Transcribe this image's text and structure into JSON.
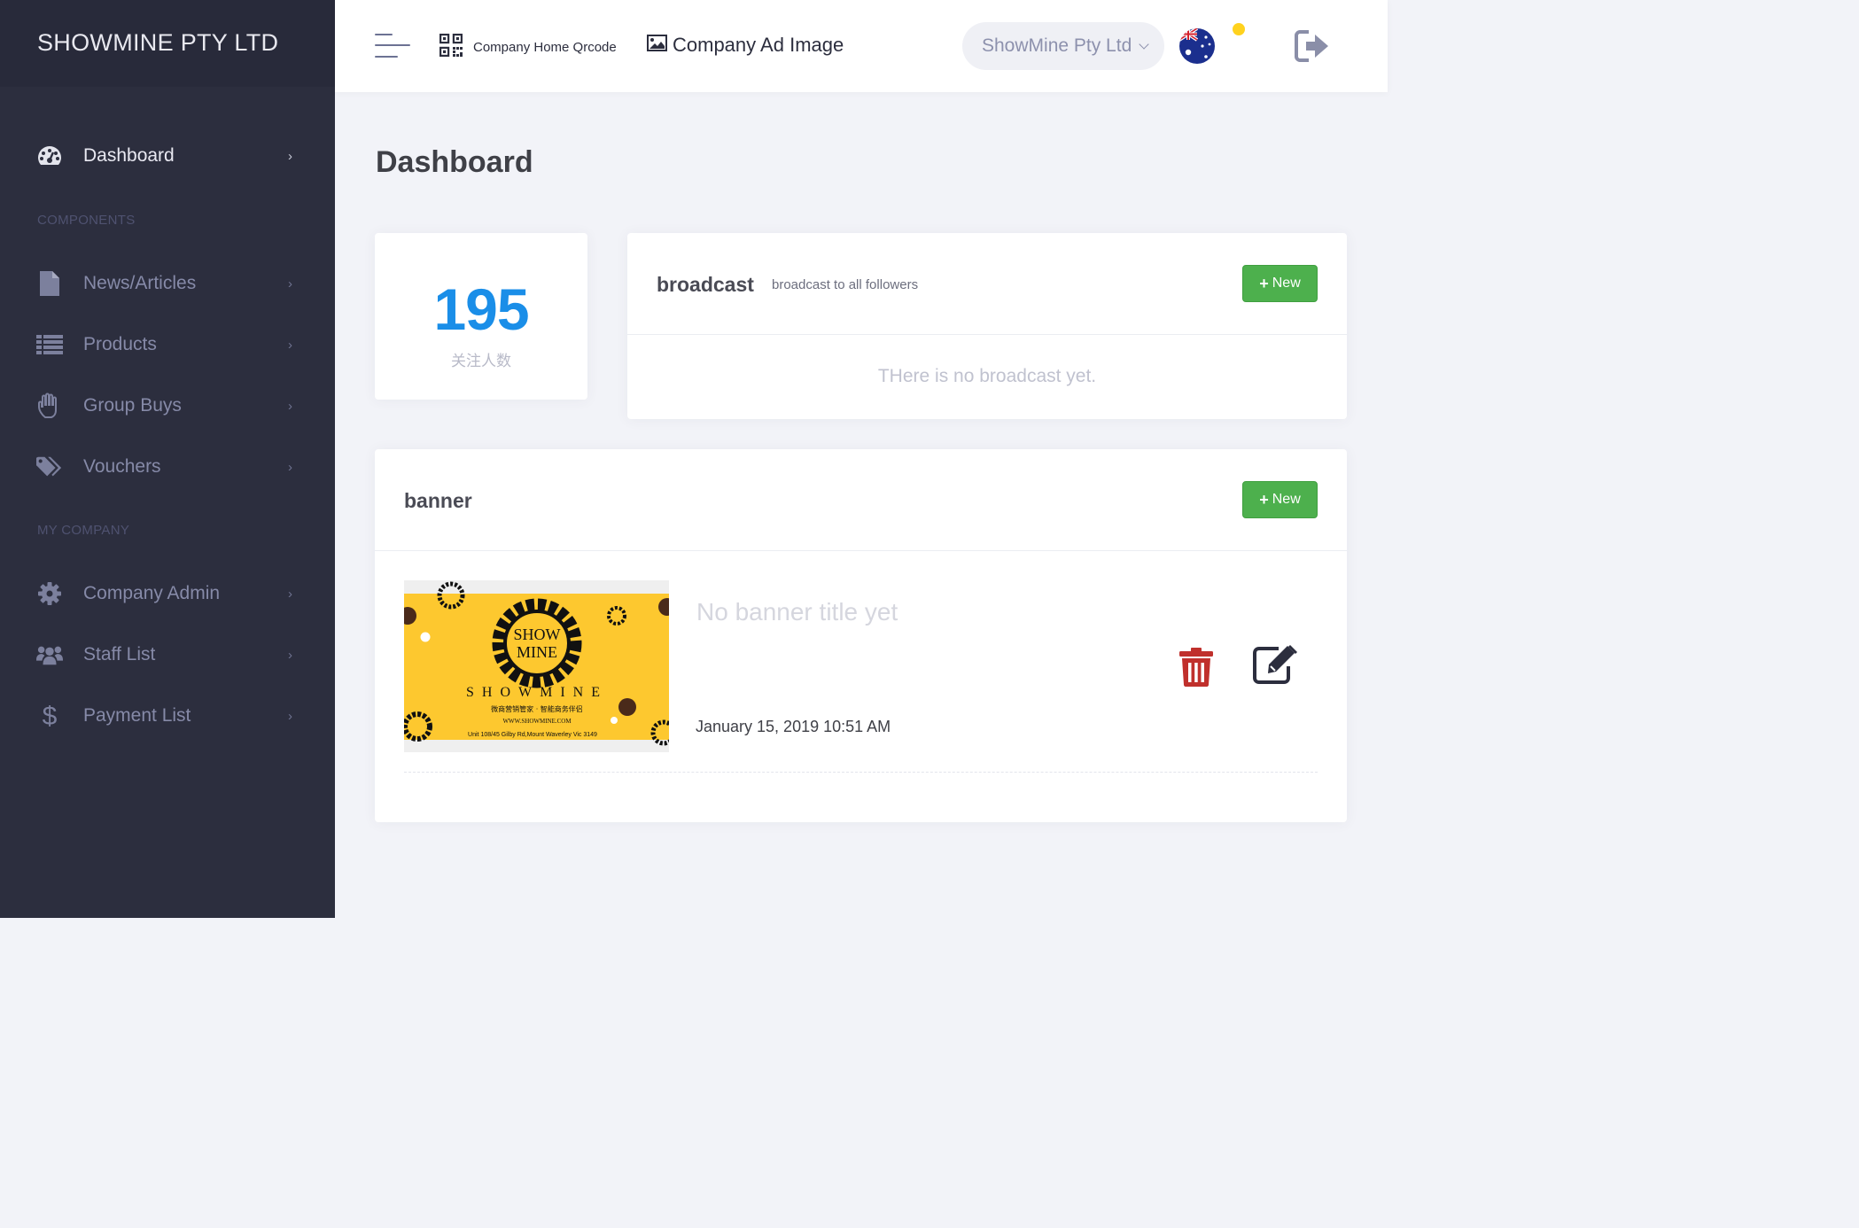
{
  "brand": {
    "name": "SHOWMINE PTY LTD"
  },
  "sidebar": {
    "items": [
      {
        "label": "Dashboard",
        "icon": "dashboard-icon",
        "active": true
      },
      {
        "label": "News/Articles",
        "icon": "document-icon"
      },
      {
        "label": "Products",
        "icon": "list-icon"
      },
      {
        "label": "Group Buys",
        "icon": "hand-icon"
      },
      {
        "label": "Vouchers",
        "icon": "tags-icon"
      },
      {
        "label": "Company Admin",
        "icon": "gear-icon"
      },
      {
        "label": "Staff List",
        "icon": "users-icon"
      },
      {
        "label": "Payment List",
        "icon": "dollar-icon"
      }
    ],
    "sections": {
      "components": "COMPONENTS",
      "my_company": "MY COMPANY"
    },
    "chevron": "›"
  },
  "header": {
    "qrcode_label": "Company Home Qrcode",
    "ad_image_label": "Company Ad Image",
    "company_selector": "ShowMine Pty Ltd",
    "flag": "australia-flag",
    "status_color": "#ffd21e"
  },
  "page": {
    "title": "Dashboard"
  },
  "stats": {
    "value": "195",
    "label": "关注人数",
    "color": "#1a8ee8"
  },
  "broadcast": {
    "title": "broadcast",
    "subtitle": "broadcast to all followers",
    "new_button": "New",
    "empty_text": "THere is no broadcast yet."
  },
  "banner": {
    "title": "banner",
    "new_button": "New",
    "item": {
      "title": "No banner title yet",
      "date": "January 15, 2019 10:51 AM",
      "image_text": {
        "logo_top": "SHOW",
        "logo_bottom": "MINE",
        "wordmark": "SHOWMINE",
        "tagline": "微商营销管家 · 智能商务伴侣",
        "website": "WWW.SHOWMINE.COM",
        "address": "Unit 108/45 Gilby Rd,Mount Waverley Vic 3149"
      }
    }
  },
  "colors": {
    "sidebar": "#2c2e3e",
    "accent_green": "#4db04d",
    "delete_red": "#c0302c"
  }
}
